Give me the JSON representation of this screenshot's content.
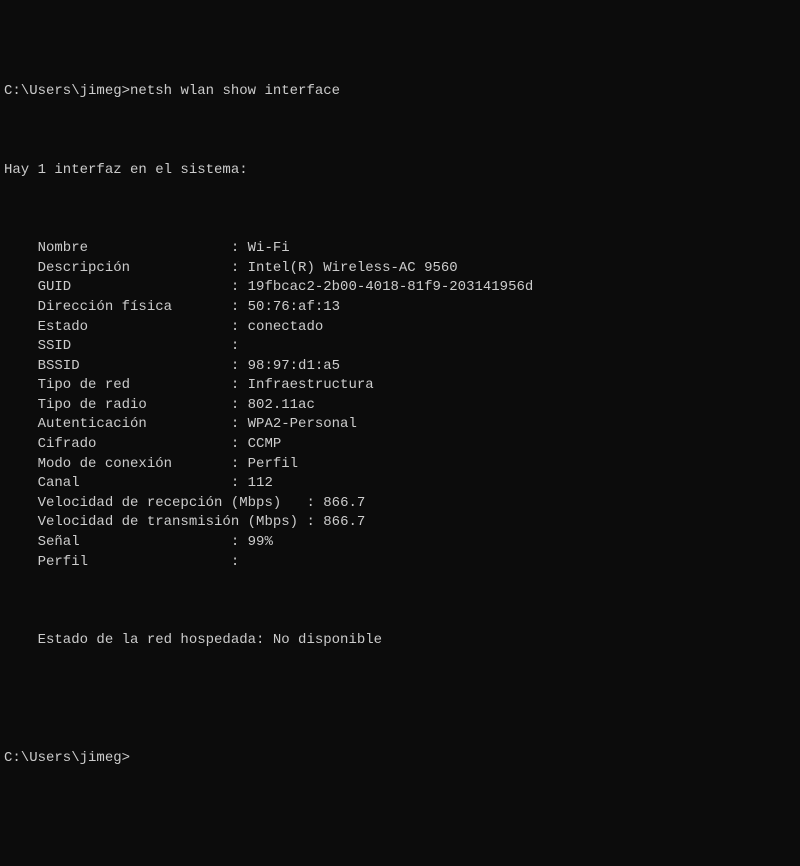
{
  "prompt1": {
    "path": "C:\\Users\\jimeg",
    "sep": ">",
    "command": "netsh wlan show interface"
  },
  "intro": "Hay 1 interfaz en el sistema:",
  "fields": [
    {
      "label": "    Nombre                 : ",
      "value": "Wi-Fi"
    },
    {
      "label": "    Descripción            : ",
      "value": "Intel(R) Wireless-AC 9560"
    },
    {
      "label": "    GUID                   : ",
      "value": "19fbcac2-2b00-4018-81f9-203141956d"
    },
    {
      "label": "    Dirección física       : ",
      "value": "50:76:af:13"
    },
    {
      "label": "    Estado                 : ",
      "value": "conectado"
    },
    {
      "label": "    SSID                   : ",
      "value": ""
    },
    {
      "label": "    BSSID                  : ",
      "value": "98:97:d1:a5"
    },
    {
      "label": "    Tipo de red            : ",
      "value": "Infraestructura"
    },
    {
      "label": "    Tipo de radio          : ",
      "value": "802.11ac"
    },
    {
      "label": "    Autenticación          : ",
      "value": "WPA2-Personal"
    },
    {
      "label": "    Cifrado                : ",
      "value": "CCMP"
    },
    {
      "label": "    Modo de conexión       : ",
      "value": "Perfil"
    },
    {
      "label": "    Canal                  : ",
      "value": "112"
    },
    {
      "label": "    Velocidad de recepción (Mbps)   : ",
      "value": "866.7"
    },
    {
      "label": "    Velocidad de transmisión (Mbps) : ",
      "value": "866.7"
    },
    {
      "label": "    Señal                  : ",
      "value": "99%"
    },
    {
      "label": "    Perfil                 : ",
      "value": ""
    }
  ],
  "hosted": {
    "label": "    Estado de la red hospedada: ",
    "value": "No disponible"
  },
  "prompt2": {
    "path": "C:\\Users\\jimeg",
    "sep": ">",
    "command": ""
  }
}
